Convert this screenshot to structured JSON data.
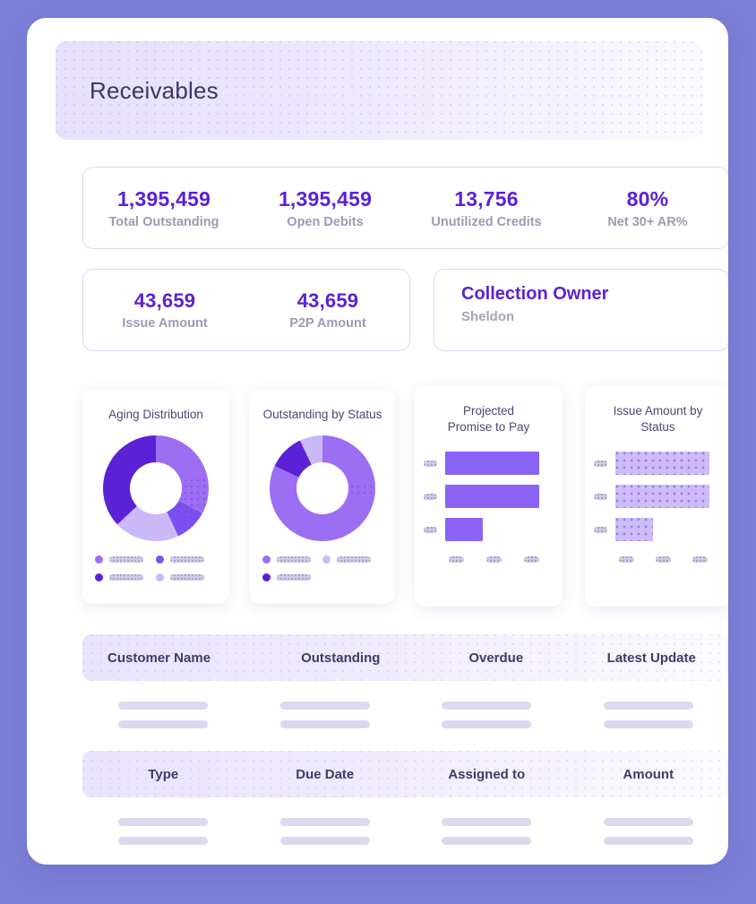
{
  "theme": {
    "page_bg": "#7b7fd8",
    "accent": "#5b21d6",
    "accent_light": "#8b63f5",
    "accent_pale": "#cdbcf7",
    "muted_text": "#9b9bb5",
    "heading_text": "#3b3862"
  },
  "header": {
    "title": "Receivables"
  },
  "kpis": [
    {
      "value": "1,395,459",
      "label": "Total Outstanding"
    },
    {
      "value": "1,395,459",
      "label": "Open Debits"
    },
    {
      "value": "13,756",
      "label": "Unutilized Credits"
    },
    {
      "value": "80%",
      "label": "Net 30+ AR%"
    }
  ],
  "secondary_kpis": [
    {
      "value": "43,659",
      "label": "Issue Amount"
    },
    {
      "value": "43,659",
      "label": "P2P Amount"
    }
  ],
  "owner": {
    "title": "Collection Owner",
    "name": "Sheldon"
  },
  "chart_data": [
    {
      "type": "pie",
      "title": "Aging Distribution",
      "legend_position": "bottom",
      "categories": [
        "Segment 1",
        "Segment 2",
        "Segment 3",
        "Segment 4"
      ],
      "values": [
        33,
        10,
        20,
        37
      ],
      "colors": [
        "#9b6ef3",
        "#7c4ff0",
        "#cbb8f7",
        "#5b21d6"
      ],
      "legend_dot_colors": [
        "#9b6ef3",
        "#7c4ff0",
        "#5b21d6",
        "#cbb8f7"
      ]
    },
    {
      "type": "pie",
      "title": "Outstanding by Status",
      "legend_position": "bottom",
      "categories": [
        "Segment 1",
        "Segment 2",
        "Segment 3"
      ],
      "values": [
        82,
        11,
        7
      ],
      "colors": [
        "#9b6ef3",
        "#5b21d6",
        "#cbb8f7"
      ],
      "legend_dot_colors": [
        "#9b6ef3",
        "#cbb8f7",
        "#5b21d6"
      ]
    },
    {
      "type": "bar",
      "orientation": "horizontal",
      "title": "Projected\nPromise to Pay",
      "title_line1": "Projected",
      "title_line2": "Promise to Pay",
      "categories": [
        "",
        "",
        ""
      ],
      "values": [
        100,
        100,
        40
      ],
      "xlim": [
        0,
        100
      ],
      "bar_style": "solid",
      "bar_color": "#8b63f5",
      "axis_tick_count": 3
    },
    {
      "type": "bar",
      "orientation": "horizontal",
      "title": "Issue Amount by\nStatus",
      "title_line1": "Issue Amount by",
      "title_line2": "Status",
      "categories": [
        "",
        "",
        ""
      ],
      "values": [
        100,
        100,
        40
      ],
      "xlim": [
        0,
        100
      ],
      "bar_style": "dotted",
      "bar_color": "#cdbcf7",
      "axis_tick_count": 3
    }
  ],
  "tables": [
    {
      "columns": [
        "Customer Name",
        "Outstanding",
        "Overdue",
        "Latest Update"
      ],
      "row_count": 2,
      "cells_loading": true
    },
    {
      "columns": [
        "Type",
        "Due Date",
        "Assigned to",
        "Amount"
      ],
      "row_count": 2,
      "cells_loading": true
    }
  ]
}
